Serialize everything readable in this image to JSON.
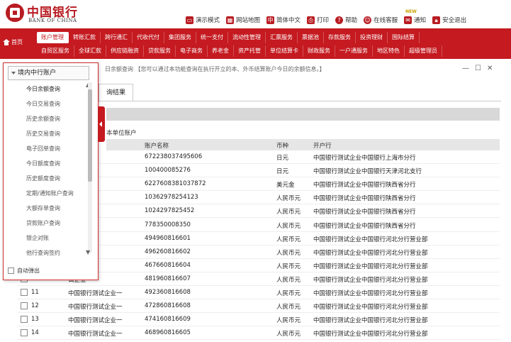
{
  "brand": {
    "name_cn": "中国银行",
    "name_en": "BANK OF CHINA"
  },
  "toplinks": [
    {
      "label": "演示模式",
      "icon": "monitor-icon"
    },
    {
      "label": "网站地图",
      "icon": "sitemap-icon"
    },
    {
      "label": "简体中文",
      "icon": "language-icon"
    },
    {
      "label": "打印",
      "icon": "printer-icon"
    },
    {
      "label": "帮助",
      "icon": "help-icon"
    },
    {
      "label": "在线客服",
      "icon": "chat-icon"
    },
    {
      "label": "通知",
      "icon": "mail-icon",
      "badge": "NEW"
    },
    {
      "label": "安全退出",
      "icon": "lock-icon"
    }
  ],
  "nav": {
    "home": "首页",
    "row1": [
      "账户管理",
      "转账汇款",
      "跨行通汇",
      "代收代付",
      "集团服务",
      "统一支付",
      "流动性管理",
      "汇票服务",
      "票据池",
      "存款服务",
      "投资理财",
      "国际结算"
    ],
    "row2": [
      "自贸区服务",
      "全球汇款",
      "供应链融资",
      "贷款服务",
      "电子商务",
      "养老金",
      "资产托管",
      "单位结算卡",
      "财政服务",
      "一户通服务",
      "地区特色",
      "超级管理员"
    ],
    "active": "账户管理"
  },
  "content": {
    "info_text": "日余额查询 【您可以通过本功能查询在执行开立的本、外币结算账户今日的余额信息。】",
    "tab_label": "询结果",
    "section_title": "本单位账户",
    "columns": [
      "账户名称",
      "币种",
      "开户行"
    ],
    "rows": [
      {
        "num": "",
        "name": "试企业一",
        "account": "672238037495606",
        "currency": "日元",
        "bank": "中国银行测试企业中国银行上海市分行"
      },
      {
        "num": "",
        "name": "试企业一",
        "account": "100400085276",
        "currency": "日元",
        "bank": "中国银行测试企业中国银行天津河北支行"
      },
      {
        "num": "",
        "name": "试企业一",
        "account": "6227608381037872",
        "currency": "美元金",
        "bank": "中国银行测试企业中国银行陕西省分行"
      },
      {
        "num": "",
        "name": "试企业一",
        "account": "10362978254123",
        "currency": "人民币元",
        "bank": "中国银行测试企业中国银行陕西省分行"
      },
      {
        "num": "",
        "name": "试企业一",
        "account": "1024297825452",
        "currency": "人民币元",
        "bank": "中国银行测试企业中国银行陕西省分行"
      },
      {
        "num": "",
        "name": "试企业一",
        "account": "778350008350",
        "currency": "人民币元",
        "bank": "中国银行测试企业中国银行陕西省分行"
      },
      {
        "num": "",
        "name": "试企业一",
        "account": "494960816601",
        "currency": "人民币元",
        "bank": "中国银行测试企业中国银行河北分行营业部"
      },
      {
        "num": "",
        "name": "试企业一",
        "account": "496260816602",
        "currency": "人民币元",
        "bank": "中国银行测试企业中国银行河北分行营业部"
      },
      {
        "num": "",
        "name": "试企业一",
        "account": "467660816604",
        "currency": "人民币元",
        "bank": "中国银行测试企业中国银行河北分行营业部"
      },
      {
        "num": "",
        "name": "试企业一",
        "account": "481960816607",
        "currency": "人民币元",
        "bank": "中国银行测试企业中国银行河北分行营业部"
      },
      {
        "num": "11",
        "name": "中国银行测试企业一",
        "account": "492360816608",
        "currency": "人民币元",
        "bank": "中国银行测试企业中国银行河北分行营业部"
      },
      {
        "num": "12",
        "name": "中国银行测试企业一",
        "account": "472860816608",
        "currency": "人民币元",
        "bank": "中国银行测试企业中国银行河北分行营业部"
      },
      {
        "num": "13",
        "name": "中国银行测试企业一",
        "account": "474160816609",
        "currency": "人民币元",
        "bank": "中国银行测试企业中国银行河北分行营业部"
      },
      {
        "num": "14",
        "name": "中国银行测试企业一",
        "account": "468960816605",
        "currency": "人民币元",
        "bank": "中国银行测试企业中国银行河北分行营业部"
      }
    ]
  },
  "popup": {
    "header": "境内中行账户",
    "items": [
      "今日余额查询",
      "今日交易查询",
      "历史余额查询",
      "历史交易查询",
      "电子回单查询",
      "今日额度查询",
      "历史额度查询",
      "定期/通知账户查询",
      "大额存单查询",
      "贷款账户查询",
      "银企对账",
      "他行查询签约"
    ],
    "selected": "今日余额查询",
    "footer_label": "自动弹出"
  },
  "colors": {
    "brand_red": "#c41a20",
    "nav_bg": "#c41a20"
  }
}
